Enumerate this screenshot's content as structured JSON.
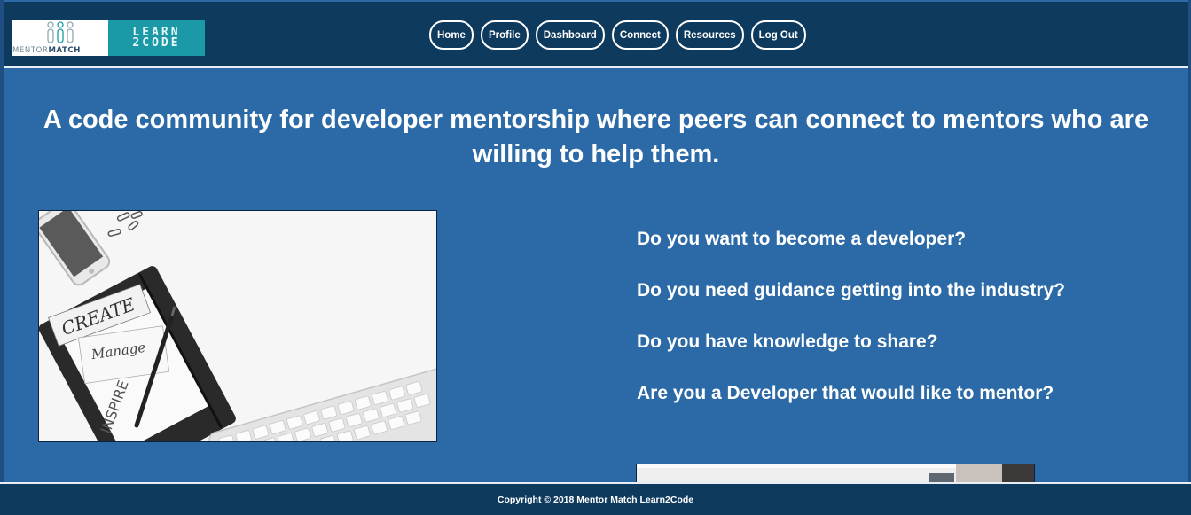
{
  "brand": {
    "mentor_match_part1": "MENTOR",
    "mentor_match_part2": "MATCH",
    "learn2code_line1": "LEARN",
    "learn2code_line2": "2CODE"
  },
  "nav": [
    {
      "label": "Home"
    },
    {
      "label": "Profile"
    },
    {
      "label": "Dashboard"
    },
    {
      "label": "Connect"
    },
    {
      "label": "Resources"
    },
    {
      "label": "Log Out"
    }
  ],
  "headline": "A code community for developer mentorship where peers can connect to mentors who are willing to help them.",
  "hero_image": {
    "words": [
      "CREATE",
      "Manage",
      "INSPIRE"
    ]
  },
  "questions": [
    "Do you want to become a developer?",
    "Do you need guidance getting into the industry?",
    "Do you have knowledge to share?",
    "Are you a Developer that would like to mentor?"
  ],
  "footer": {
    "copyright": "Copyright © 2018 Mentor Match Learn2Code"
  },
  "colors": {
    "page_bg": "#2b6aa6",
    "header_bg": "#0e3a5e",
    "logo_teal": "#1b99a6"
  }
}
